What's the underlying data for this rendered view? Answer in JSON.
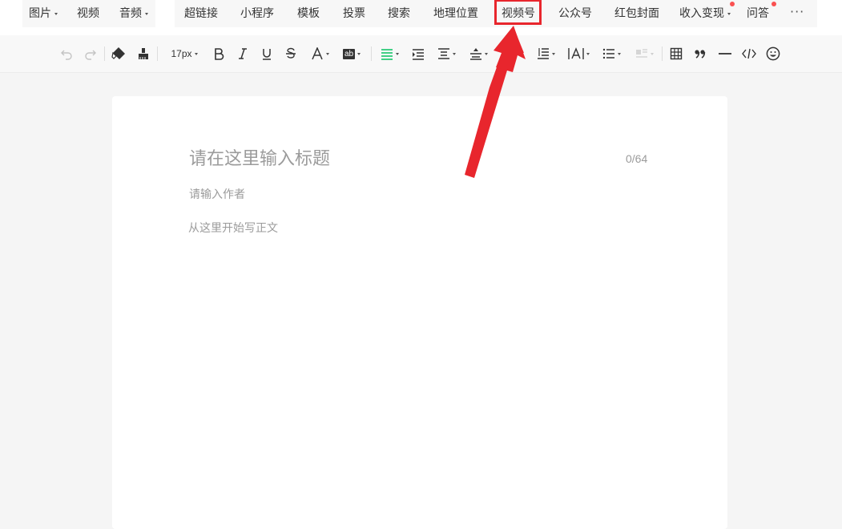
{
  "topbar": {
    "group1": [
      {
        "label": "图片",
        "dropdown": true
      },
      {
        "label": "视频",
        "dropdown": false
      },
      {
        "label": "音频",
        "dropdown": true
      }
    ],
    "group2": [
      {
        "label": "超链接"
      },
      {
        "label": "小程序"
      },
      {
        "label": "模板"
      },
      {
        "label": "投票"
      },
      {
        "label": "搜索"
      },
      {
        "label": "地理位置"
      },
      {
        "label": "视频号",
        "highlighted": true
      },
      {
        "label": "公众号"
      },
      {
        "label": "红包封面"
      },
      {
        "label": "收入变现",
        "dropdown": true,
        "badge": true
      },
      {
        "label": "问答",
        "badge": true
      }
    ],
    "more_label": "···"
  },
  "toolbar": {
    "font_size": "17px",
    "highlight_label": "ab",
    "icons": [
      "undo-icon",
      "redo-icon",
      "eraser-icon",
      "format-brush-icon",
      "bold-icon",
      "italic-icon",
      "underline-icon",
      "strikethrough-icon",
      "font-color-icon",
      "background-color-icon",
      "align-icon",
      "indent-icon",
      "paragraph-spacing-icon",
      "line-height-icon",
      "letter-spacing-icon",
      "line-spacing-icon",
      "text-width-icon",
      "list-icon",
      "float-icon",
      "table-icon",
      "quote-icon",
      "divider-icon",
      "code-icon",
      "emoji-icon"
    ]
  },
  "editor": {
    "title_placeholder": "请在这里输入标题",
    "title_count": "0/64",
    "author_placeholder": "请输入作者",
    "body_placeholder": "从这里开始写正文"
  },
  "colors": {
    "accent_green": "#07c160",
    "highlight_red": "#e8262d",
    "badge_red": "#fa5151"
  }
}
